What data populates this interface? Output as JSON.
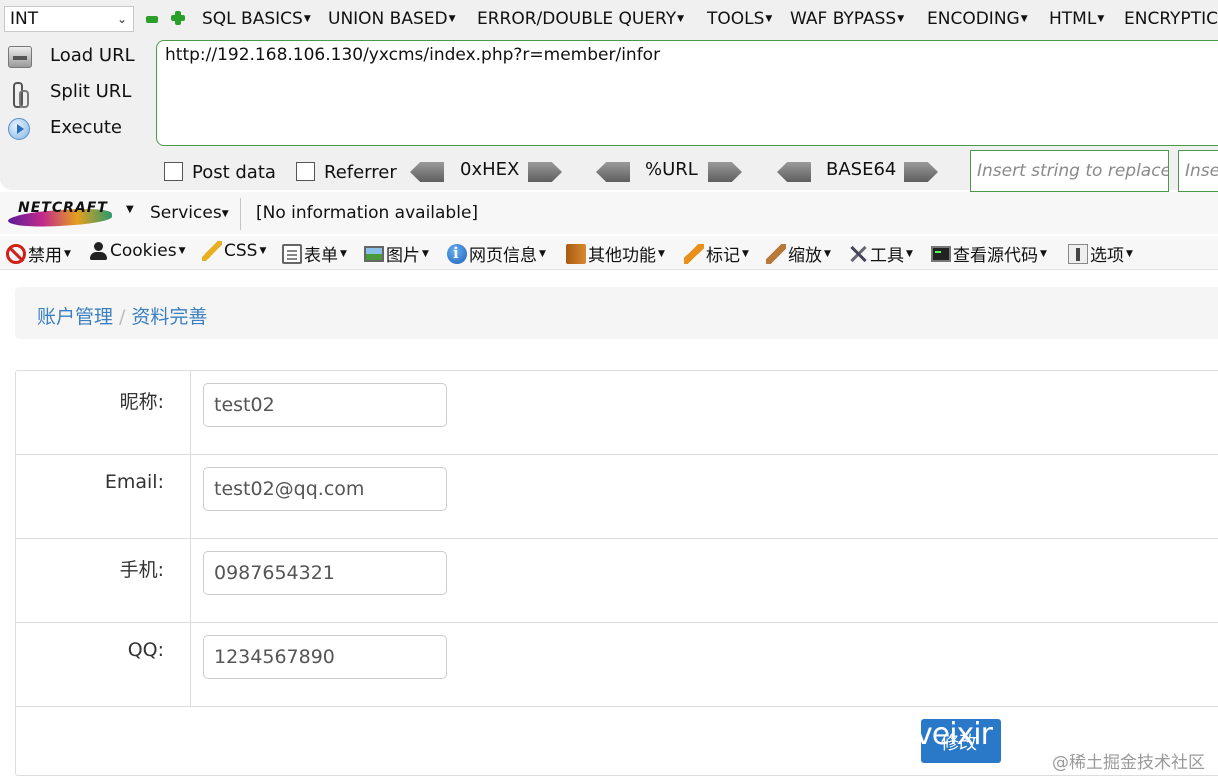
{
  "hackbar": {
    "select_value": "INT",
    "menus": [
      "SQL BASICS",
      "UNION BASED",
      "ERROR/DOUBLE QUERY",
      "TOOLS",
      "WAF BYPASS",
      "ENCODING",
      "HTML",
      "ENCRYPTIC"
    ],
    "side_buttons": [
      "Load URL",
      "Split URL",
      "Execute"
    ],
    "url_value": "http://192.168.106.130/yxcms/index.php?r=member/infor",
    "post_data_label": "Post data",
    "referrer_label": "Referrer",
    "encoders": [
      "0xHEX",
      "%URL",
      "BASE64"
    ],
    "replace_placeholder": "Insert string to replace",
    "replace_with_placeholder": "Inse"
  },
  "netcraft": {
    "logo_text": "NETCRAFT",
    "services_label": "Services",
    "info_text": "[No information available]"
  },
  "webdev": {
    "items": [
      "禁用",
      "Cookies",
      "CSS",
      "表单",
      "图片",
      "网页信息",
      "其他功能",
      "标记",
      "缩放",
      "工具",
      "查看源代码",
      "选项"
    ]
  },
  "breadcrumb": {
    "items": [
      "账户管理",
      "资料完善"
    ],
    "separator": "/"
  },
  "form": {
    "rows": [
      {
        "label": "昵称:",
        "value": "test02"
      },
      {
        "label": "Email:",
        "value": "test02@qq.com"
      },
      {
        "label": "手机:",
        "value": "0987654321"
      },
      {
        "label": "QQ:",
        "value": "1234567890"
      }
    ],
    "submit_label": "修改",
    "submit_overlay": "veixir"
  },
  "watermark": "@稀土掘金技术社区",
  "colors": {
    "link": "#3a7fc0",
    "primary_button": "#2a78c8",
    "hackbar_border": "#4a9a4a"
  }
}
